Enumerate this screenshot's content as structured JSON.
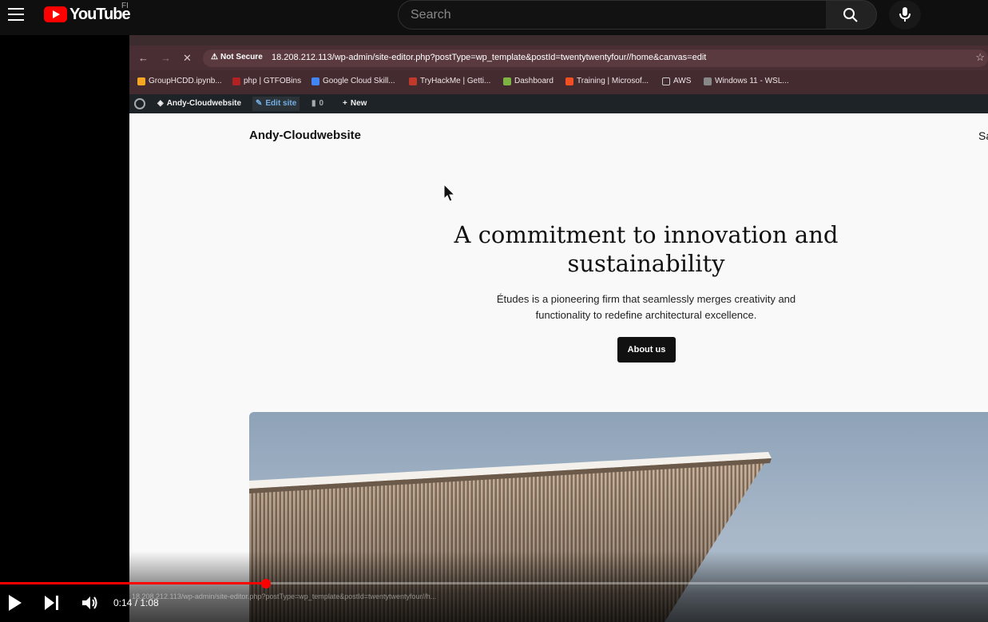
{
  "youtube": {
    "logo_text": "YouTube",
    "region": "FI",
    "search_placeholder": "Search"
  },
  "browser": {
    "security": "Not Secure",
    "url": "18.208.212.113/wp-admin/site-editor.php?postType=wp_template&postId=twentytwentyfour//home&canvas=edit",
    "bookmarks": [
      {
        "label": "GroupHCDD.ipynb...",
        "color": "#f5a623"
      },
      {
        "label": "php | GTFOBins",
        "color": "#b22222"
      },
      {
        "label": "Google Cloud Skill...",
        "color": "#4285f4"
      },
      {
        "label": "TryHackMe | Getti...",
        "color": "#c0392b"
      },
      {
        "label": "Dashboard",
        "color": "#7cb342"
      },
      {
        "label": "Training | Microsof...",
        "color": "#f25022"
      },
      {
        "label": "AWS",
        "color": "#cccccc"
      },
      {
        "label": "Windows 11 - WSL...",
        "color": "#888888"
      }
    ]
  },
  "wp_admin": {
    "site_name": "Andy-Cloudwebsite",
    "edit_site": "Edit site",
    "comments_count": "0",
    "new_label": "New"
  },
  "site": {
    "title": "Andy-Cloudwebsite",
    "nav_partial": "Sa",
    "headline": "A commitment to innovation and sustainability",
    "subtext": "Études is a pioneering firm that seamlessly merges creativity and functionality to redefine architectural excellence.",
    "cta": "About us"
  },
  "player": {
    "current_time": "0:14",
    "duration": "1:08",
    "time_display": "0:14 / 1:08",
    "progress_fraction": 0.269,
    "status_url": "18.208.212.113/wp-admin/site-editor.php?postType=wp_template&postId=twentytwentyfour//h..."
  }
}
